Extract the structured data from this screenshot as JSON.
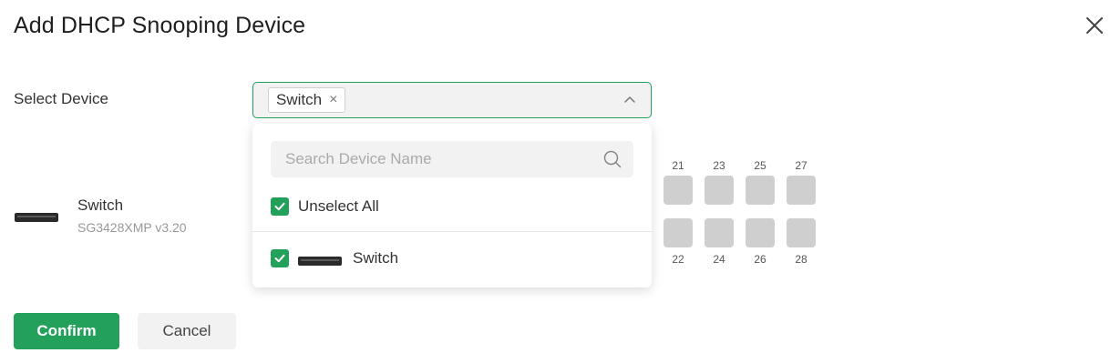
{
  "dialog": {
    "title": "Add DHCP Snooping Device"
  },
  "form": {
    "select_device_label": "Select Device",
    "selected_tag": "Switch",
    "tag_remove": "×"
  },
  "device": {
    "name": "Switch",
    "model": "SG3428XMP v3.20"
  },
  "ports": {
    "top_numbers": [
      "21",
      "23",
      "25",
      "27"
    ],
    "bottom_numbers": [
      "22",
      "24",
      "26",
      "28"
    ]
  },
  "dropdown": {
    "search_placeholder": "Search Device Name",
    "unselect_all_label": "Unselect All",
    "options": [
      {
        "label": "Switch",
        "checked": true
      }
    ]
  },
  "buttons": {
    "confirm": "Confirm",
    "cancel": "Cancel"
  },
  "colors": {
    "accent": "#23a15a",
    "port": "#cfcfcf"
  }
}
